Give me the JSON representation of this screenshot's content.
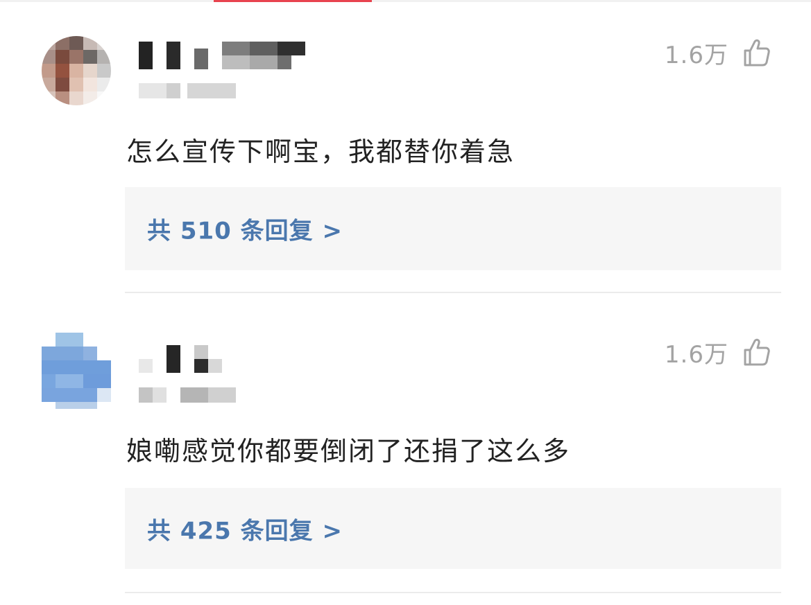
{
  "colors": {
    "accent": "#e8434f",
    "link": "#4a77ad",
    "like": "#a3a3a3"
  },
  "comments": [
    {
      "text": "怎么宣传下啊宝，我都替你着急",
      "likes": "1.6万",
      "reply_link": "共 510 条回复 >"
    },
    {
      "text": "娘嘞感觉你都要倒闭了还捐了这么多",
      "likes": "1.6万",
      "reply_link": "共 425 条回复 >"
    }
  ],
  "icons": {
    "like": "thumbs-up-icon"
  }
}
